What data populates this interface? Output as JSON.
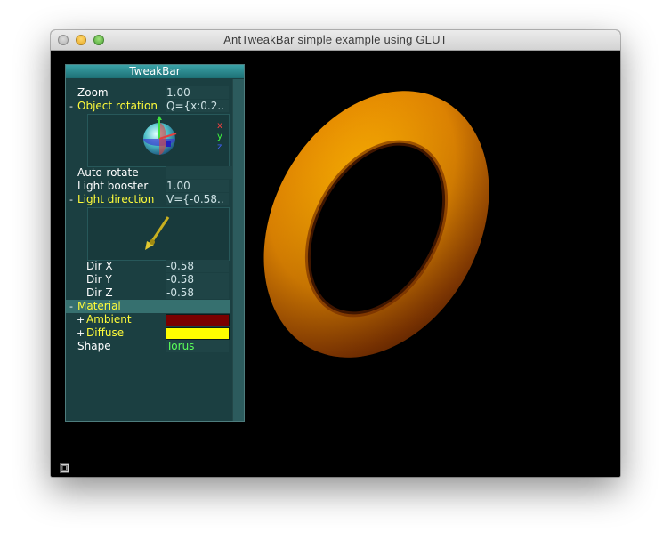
{
  "window": {
    "title": "AntTweakBar simple example using GLUT"
  },
  "tweakbar": {
    "title": "TweakBar",
    "rows": {
      "zoom": {
        "label": "Zoom",
        "value": "1.00"
      },
      "object_rotation": {
        "sign": "-",
        "label": "Object rotation",
        "value": "Q={x:0.2.."
      },
      "auto_rotate": {
        "label": "Auto-rotate",
        "value": "-"
      },
      "light_booster": {
        "label": "Light booster",
        "value": "1.00"
      },
      "light_direction": {
        "sign": "-",
        "label": "Light direction",
        "value": "V={-0.58.."
      },
      "dir_x": {
        "label": "Dir X",
        "value": "-0.58"
      },
      "dir_y": {
        "label": "Dir Y",
        "value": "-0.58"
      },
      "dir_z": {
        "label": "Dir Z",
        "value": "-0.58"
      },
      "material": {
        "sign": "-",
        "label": "Material"
      },
      "ambient": {
        "sign": "+",
        "label": "Ambient",
        "color": "#7a0000"
      },
      "diffuse": {
        "sign": "+",
        "label": "Diffuse",
        "color": "#ffff00"
      },
      "shape": {
        "label": "Shape",
        "value": "Torus"
      }
    },
    "axis_labels": {
      "x": "x",
      "y": "y",
      "z": "z"
    }
  },
  "scene": {
    "object": "torus",
    "torus_color": "#f7a400"
  }
}
